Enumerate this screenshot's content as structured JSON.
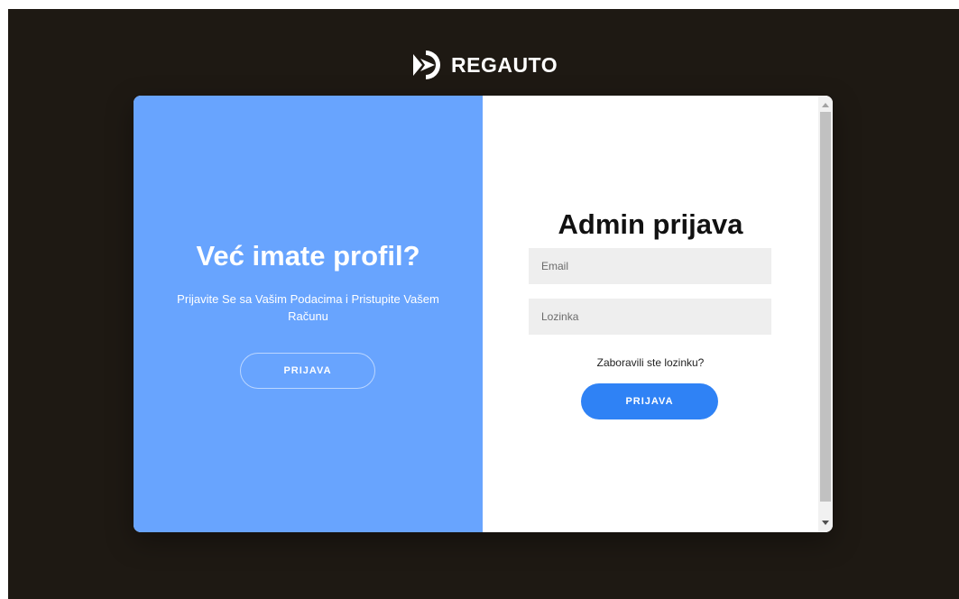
{
  "brand": {
    "name": "REGAUTO",
    "logo_icon": "regauto-logo-icon"
  },
  "left_panel": {
    "title": "Već imate profil?",
    "subtitle": "Prijavite Se sa Vašim Podacima i Pristupite Vašem Računu",
    "button_label": "PRIJAVA",
    "background_color": "#68a4fe"
  },
  "right_panel": {
    "title": "Admin prijava",
    "email_placeholder": "Email",
    "password_placeholder": "Lozinka",
    "forgot_password": "Zaboravili ste lozinku?",
    "submit_label": "PRIJAVA",
    "button_color": "#2f82f5"
  },
  "page": {
    "background_color": "#1e1913"
  }
}
